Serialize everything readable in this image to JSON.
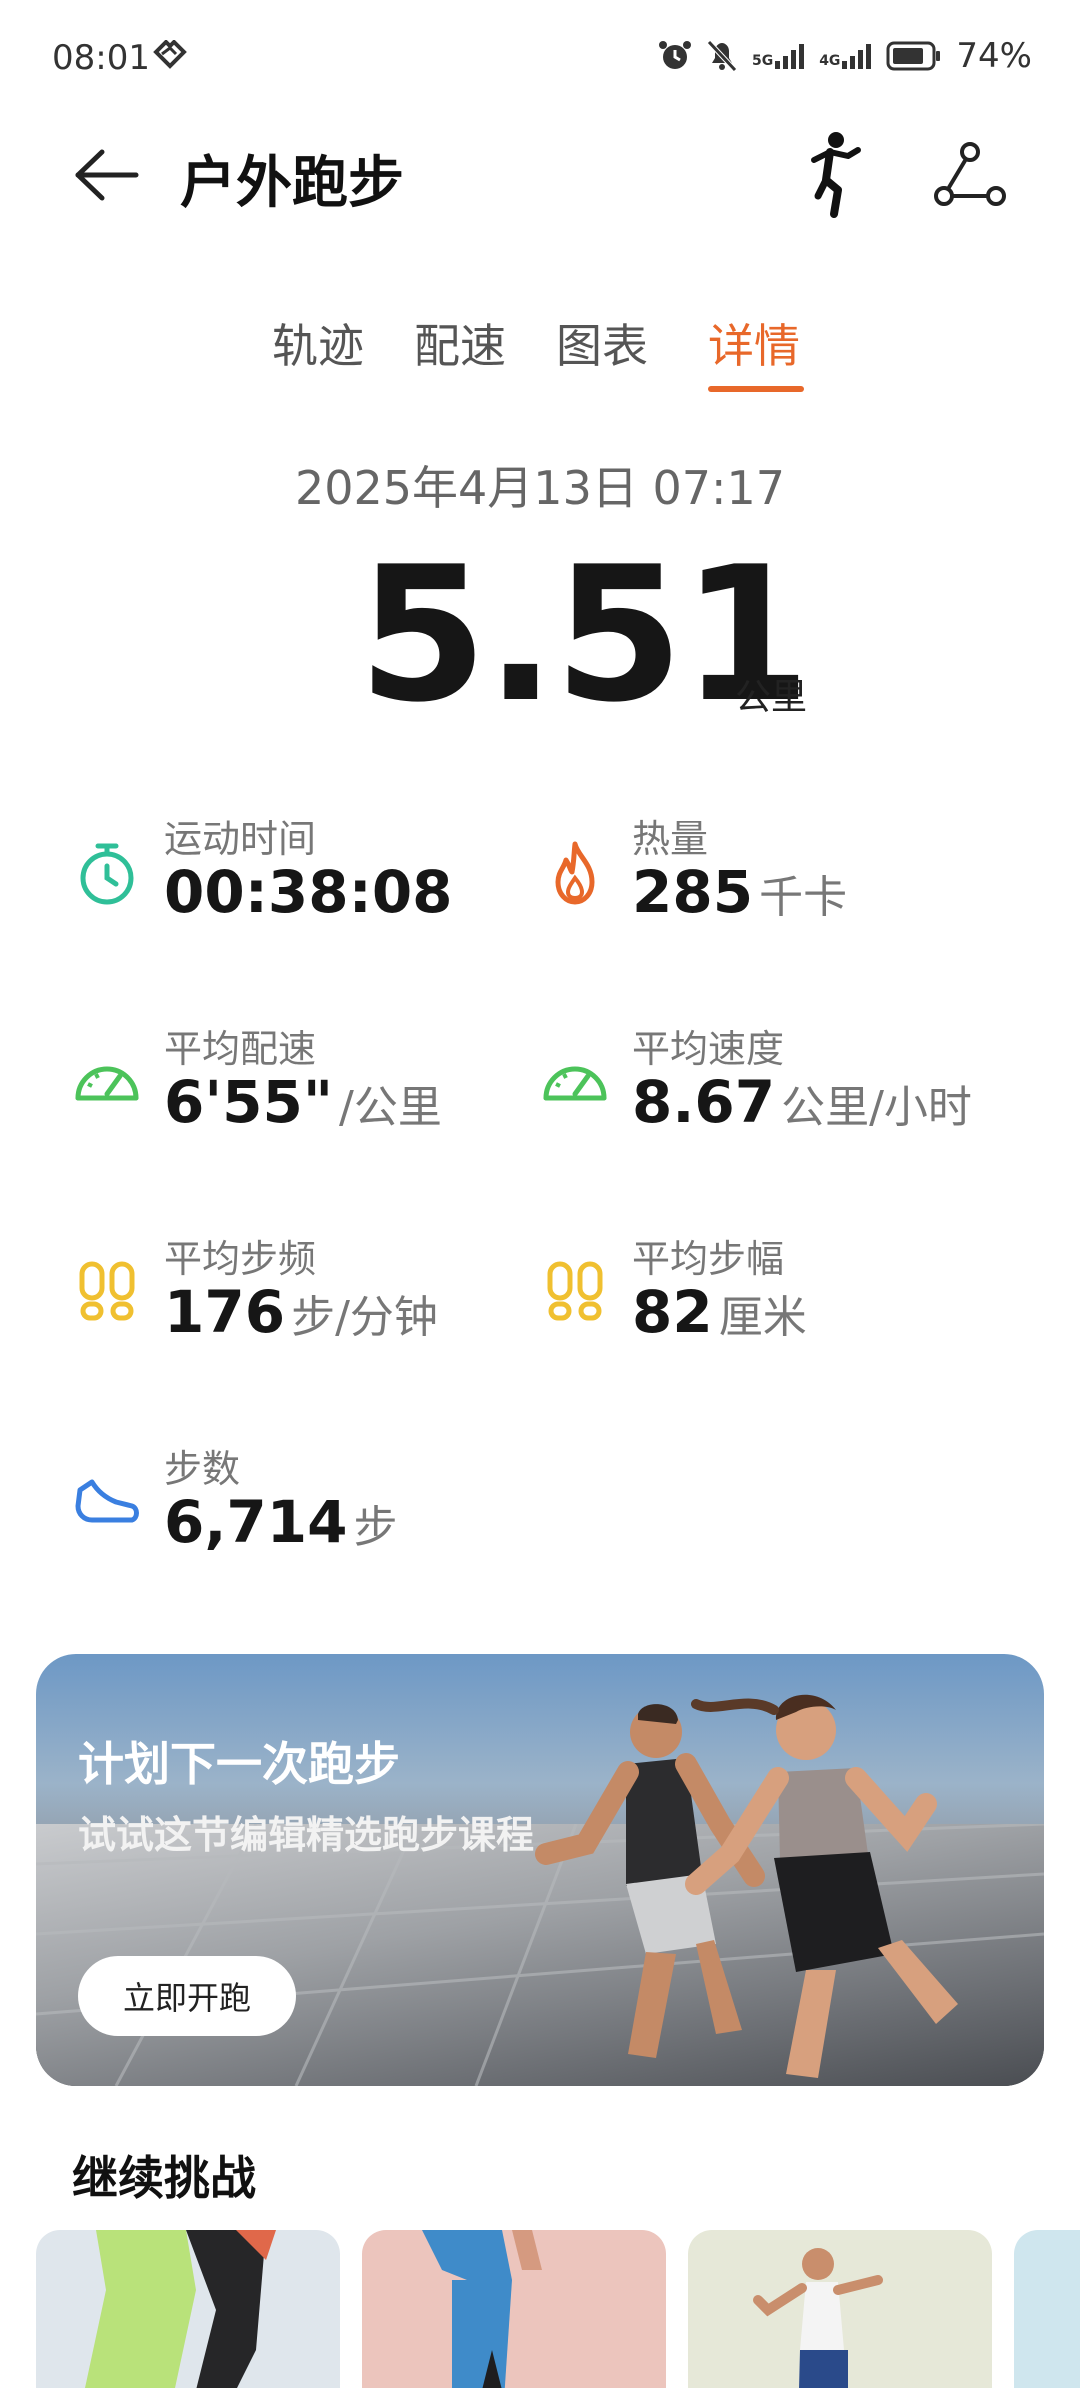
{
  "status_bar": {
    "time": "08:01",
    "network_1": "5G",
    "network_2": "4G",
    "battery": "74%"
  },
  "header": {
    "title": "户外跑步"
  },
  "tabs": [
    {
      "label": "轨迹",
      "active": false
    },
    {
      "label": "配速",
      "active": false
    },
    {
      "label": "图表",
      "active": false
    },
    {
      "label": "详情",
      "active": true
    }
  ],
  "summary": {
    "datetime": "2025年4月13日 07:17",
    "distance": "5.51",
    "distance_unit": "公里"
  },
  "stats": [
    {
      "label": "运动时间",
      "value": "00:38:08",
      "unit": "",
      "icon": "stopwatch-icon",
      "color": "#2fbf98"
    },
    {
      "label": "热量",
      "value": "285",
      "unit": "千卡",
      "icon": "flame-icon",
      "color": "#e8682a"
    },
    {
      "label": "平均配速",
      "value": "6'55\"",
      "unit": "/公里",
      "icon": "speedometer-icon",
      "color": "#4cc35a"
    },
    {
      "label": "平均速度",
      "value": "8.67",
      "unit": "公里/小时",
      "icon": "speedometer-icon",
      "color": "#4cc35a"
    },
    {
      "label": "平均步频",
      "value": "176",
      "unit": "步/分钟",
      "icon": "footprints-icon",
      "color": "#f0c030"
    },
    {
      "label": "平均步幅",
      "value": "82",
      "unit": "厘米",
      "icon": "footprints-icon",
      "color": "#f0c030"
    },
    {
      "label": "步数",
      "value": "6,714",
      "unit": "步",
      "icon": "shoe-icon",
      "color": "#3a7fe0"
    }
  ],
  "banner": {
    "title": "计划下一次跑步",
    "subtitle": "试试这节编辑精选跑步课程",
    "button_label": "立即开跑"
  },
  "challenges": {
    "title": "继续挑战"
  }
}
